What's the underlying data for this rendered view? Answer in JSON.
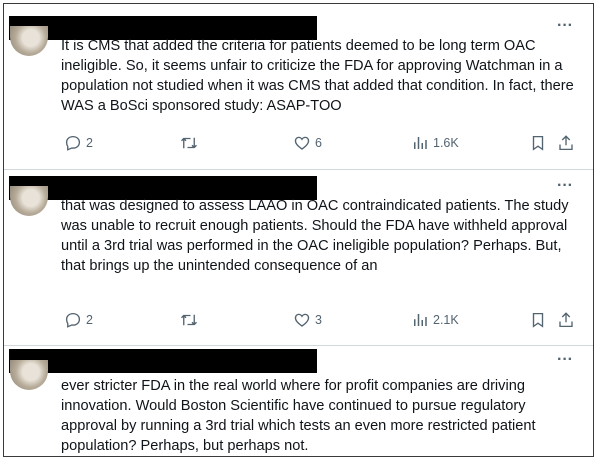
{
  "tweets": [
    {
      "text": "It is CMS that added the criteria for patients deemed to be long term OAC ineligible. So, it seems unfair to criticize the FDA for approving Watchman in a population not studied when it was CMS that added that condition. In fact, there WAS a BoSci sponsored study: ASAP-TOO",
      "replies": "2",
      "retweets": "",
      "likes": "6",
      "views": "1.6K"
    },
    {
      "text": "that was designed to assess LAAO in OAC contraindicated patients. The study was unable to recruit enough patients. Should the FDA have withheld approval until a 3rd trial was performed in the OAC ineligible population? Perhaps. But, that brings up the unintended consequence of an",
      "replies": "2",
      "retweets": "",
      "likes": "3",
      "views": "2.1K"
    },
    {
      "text": "ever stricter FDA in the real world where for profit companies are driving innovation. Would Boston Scientific have continued to pursue regulatory approval by running a 3rd trial which tests an even more restricted patient population? Perhaps, but perhaps not."
    }
  ],
  "icons": {
    "more": "more-icon",
    "reply": "reply-icon",
    "retweet": "retweet-icon",
    "like": "heart-icon",
    "views": "views-icon",
    "bookmark": "bookmark-icon",
    "share": "share-icon"
  },
  "colors": {
    "text": "#0f1419",
    "muted": "#536471",
    "divider": "#cfd9de",
    "redaction": "#000000"
  }
}
